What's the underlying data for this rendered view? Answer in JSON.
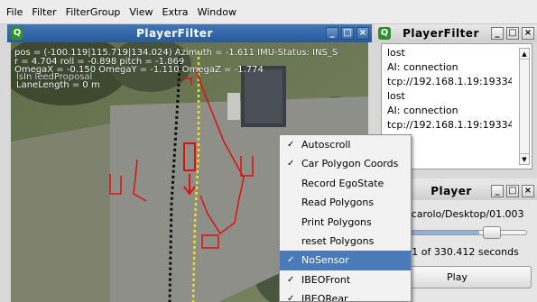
{
  "menubar": [
    "File",
    "Filter",
    "FilterGroup",
    "View",
    "Extra",
    "Window"
  ],
  "map_window": {
    "title": "PlayerFilter",
    "icon": "Q"
  },
  "map_overlay": {
    "line1": "pos = (-100.119|115.719|134.024) Azimuth = -1.611 IMU-Status: INS_S",
    "line2": "r = 4.704 roll = -0.898 pitch = -1.869",
    "line3": "OmegaX = -0.150 OmegaY = -1.110 OmegaZ = -1.774",
    "line4": "lsIn leedProposal",
    "line5": "LaneLength       = 0 m"
  },
  "filter_window": {
    "title": "PlayerFilter",
    "icon": "Q",
    "lines": [
      "lost",
      "AI: connection",
      "tcp://192.168.1.19:19334",
      "lost",
      "AI: connection",
      "tcp://192.168.1.19:19334"
    ]
  },
  "player_window": {
    "title": "Player",
    "path": "/carolo/Desktop/01.003",
    "time": ")1 of 330.412 seconds",
    "play_label": "Play",
    "progress": 0.6
  },
  "context_menu": {
    "items": [
      {
        "label": "Autoscroll",
        "checked": "✓"
      },
      {
        "label": "Car Polygon Coords",
        "checked": "✓"
      },
      {
        "label": "Record EgoState",
        "checked": ""
      },
      {
        "label": "Read Polygons",
        "checked": ""
      },
      {
        "label": "Print Polygons",
        "checked": ""
      },
      {
        "label": "reset Polygons",
        "checked": ""
      },
      {
        "label": "NoSensor",
        "checked": "✓"
      },
      {
        "label": "IBEOFront",
        "checked": "✓"
      },
      {
        "label": "IBEORear",
        "checked": "✓"
      }
    ],
    "selected_index": 6
  },
  "colors": {
    "accent": "#3f77b8",
    "selection": "#4a7ab8",
    "overlay_red": "#e01010",
    "overlay_yellow": "#f0e020"
  }
}
